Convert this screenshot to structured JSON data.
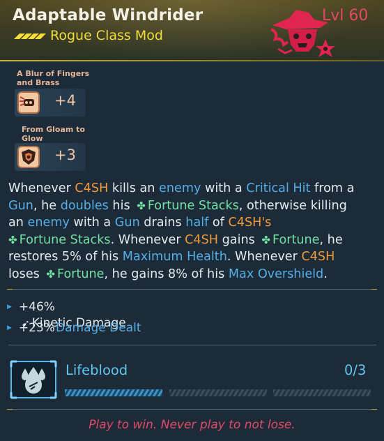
{
  "header": {
    "name": "Adaptable Windrider",
    "type": "Rogue Class Mod",
    "level": "Lvl 60",
    "rarity_icon": "legendary-chevrons-icon",
    "emblem_icon": "vault-hunter-emblem-icon"
  },
  "skills": [
    {
      "title_line1": "A Blur of Fingers",
      "title_line2": "and Brass",
      "value": "+4",
      "icon": "brass-knuckles-icon"
    },
    {
      "title_line1": "From Gloam to",
      "title_line2": "Glow",
      "value": "+3",
      "icon": "shield-badge-icon"
    }
  ],
  "description": {
    "l1_a": "Whenever ",
    "l1_b": "C4SH",
    "l1_c": " kills an ",
    "l1_d": "enemy",
    "l1_e": " with a ",
    "l1_f": "Critical Hit",
    "l1_g": " from a",
    "l2_a": "Gun",
    "l2_b": ", he ",
    "l2_c": "doubles",
    "l2_d": " his ",
    "l2_e": "Fortune Stacks",
    "l2_f": ", otherwise killing",
    "l3_a": "an ",
    "l3_b": "enemy",
    "l3_c": " with a ",
    "l3_d": "Gun",
    "l3_e": " drains ",
    "l3_f": "half",
    "l3_g": " of ",
    "l3_h": "C4SH's",
    "l4_a": "Fortune Stacks",
    "l4_b": ". Whenever ",
    "l4_c": "C4SH",
    "l4_d": " gains ",
    "l4_e": "Fortune",
    "l4_f": ", he",
    "l5_a": "restores 5% of his ",
    "l5_b": "Maximum Health",
    "l5_c": ". Whenever ",
    "l5_d": "C4SH",
    "l6_a": "loses ",
    "l6_b": "Fortune",
    "l6_c": ", he gains 8% of his ",
    "l6_d": "Max Overshield",
    "l6_e": "."
  },
  "stats": {
    "row1_value": "+46%",
    "row2_value": "+23%",
    "overlay_icon": "kinetic-damage-icon",
    "overlay_text1": "Kinetic Damage",
    "overlay_text2": "Damage Dealt"
  },
  "lifeblood": {
    "name": "Lifeblood",
    "count": "0/3",
    "icon": "blood-drops-icon",
    "progress": 0
  },
  "flavor_text": "Play to win. Never play to not lose.",
  "colors": {
    "keyword_orange": "#f09a3a",
    "keyword_blue": "#54aee8",
    "keyword_green": "#72e2a4",
    "level_red": "#e14a66",
    "type_yellow": "#f1dc3a"
  }
}
